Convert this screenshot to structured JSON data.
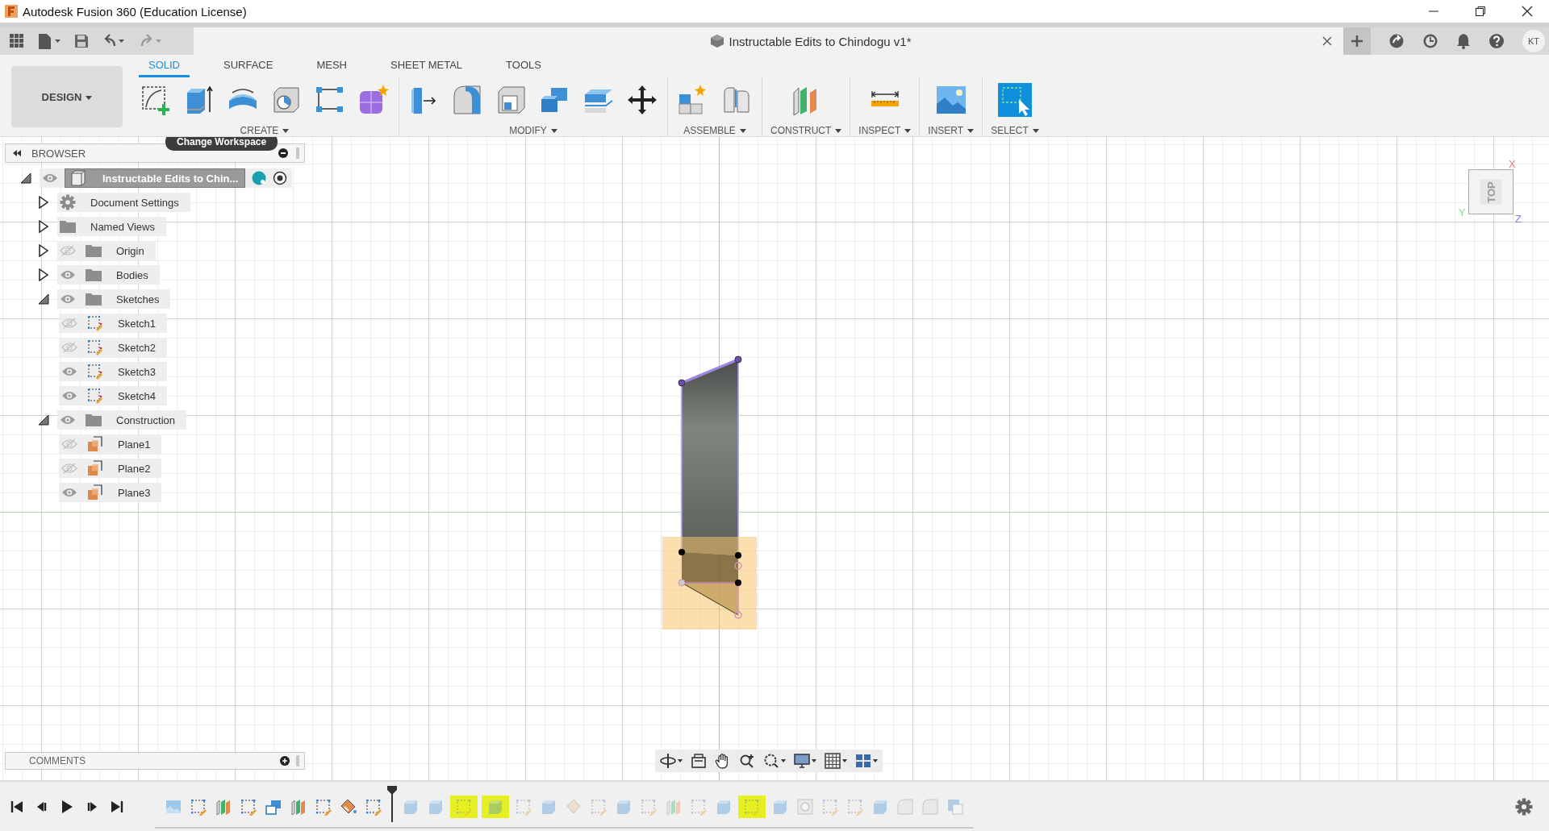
{
  "window": {
    "title": "Autodesk Fusion 360 (Education License)"
  },
  "document_tab": {
    "title": "Instructable Edits to Chindogu v1*"
  },
  "user": {
    "initials": "KT"
  },
  "workspace": {
    "label": "DESIGN"
  },
  "tabs": [
    {
      "label": "SOLID",
      "selected": true
    },
    {
      "label": "SURFACE",
      "selected": false
    },
    {
      "label": "MESH",
      "selected": false
    },
    {
      "label": "SHEET METAL",
      "selected": false
    },
    {
      "label": "TOOLS",
      "selected": false
    }
  ],
  "tool_groups": [
    {
      "label": "CREATE",
      "tools": [
        {
          "kind": "sketch"
        },
        {
          "kind": "extrude"
        },
        {
          "kind": "revolve"
        },
        {
          "kind": "hole"
        },
        {
          "kind": "pattern"
        },
        {
          "kind": "form"
        }
      ]
    },
    {
      "label": "MODIFY",
      "tools": [
        {
          "kind": "presspull"
        },
        {
          "kind": "fillet"
        },
        {
          "kind": "shell"
        },
        {
          "kind": "combine"
        },
        {
          "kind": "offset"
        },
        {
          "kind": "move"
        }
      ]
    },
    {
      "label": "ASSEMBLE",
      "tools": [
        {
          "kind": "component"
        },
        {
          "kind": "joint"
        }
      ]
    },
    {
      "label": "CONSTRUCT",
      "tools": [
        {
          "kind": "plane"
        }
      ]
    },
    {
      "label": "INSPECT",
      "tools": [
        {
          "kind": "measure"
        }
      ]
    },
    {
      "label": "INSERT",
      "tools": [
        {
          "kind": "image"
        }
      ]
    },
    {
      "label": "SELECT",
      "tools": [
        {
          "kind": "select"
        }
      ]
    }
  ],
  "tooltip": {
    "text": "Change Workspace"
  },
  "browser": {
    "title": "BROWSER",
    "root": {
      "label": "Instructable Edits to Chin...",
      "visible": true,
      "expanded": true,
      "selected": true
    },
    "items": [
      {
        "label": "Document Settings",
        "kind": "settings",
        "expanded": false
      },
      {
        "label": "Named Views",
        "kind": "folder",
        "expanded": false
      },
      {
        "label": "Origin",
        "kind": "folder",
        "visible": false,
        "expanded": false
      },
      {
        "label": "Bodies",
        "kind": "folder",
        "visible": true,
        "expanded": false
      },
      {
        "label": "Sketches",
        "kind": "folder",
        "visible": true,
        "expanded": true,
        "children": [
          {
            "label": "Sketch1",
            "kind": "sketch",
            "visible": false
          },
          {
            "label": "Sketch2",
            "kind": "sketch",
            "visible": false
          },
          {
            "label": "Sketch3",
            "kind": "sketch",
            "visible": true
          },
          {
            "label": "Sketch4",
            "kind": "sketch",
            "visible": true
          }
        ]
      },
      {
        "label": "Construction",
        "kind": "folder",
        "visible": true,
        "expanded": true,
        "children": [
          {
            "label": "Plane1",
            "kind": "plane",
            "visible": false
          },
          {
            "label": "Plane2",
            "kind": "plane",
            "visible": false
          },
          {
            "label": "Plane3",
            "kind": "plane",
            "visible": true
          }
        ]
      }
    ]
  },
  "comments": {
    "title": "COMMENTS"
  },
  "viewcube": {
    "face": "TOP",
    "x_axis": "X",
    "y_axis": "Y",
    "z_axis": "Z"
  },
  "timeline": {
    "features": [
      {
        "kind": "canvas",
        "active": true,
        "highlighted": false
      },
      {
        "kind": "sketch",
        "active": true,
        "highlighted": false
      },
      {
        "kind": "plane",
        "active": true,
        "highlighted": false
      },
      {
        "kind": "sketch",
        "active": true,
        "highlighted": false
      },
      {
        "kind": "combine",
        "active": true,
        "highlighted": false
      },
      {
        "kind": "plane",
        "active": true,
        "highlighted": false
      },
      {
        "kind": "sketch",
        "active": true,
        "highlighted": false
      },
      {
        "kind": "appearance",
        "active": true,
        "highlighted": false
      },
      {
        "kind": "sketch",
        "active": true,
        "highlighted": false
      },
      {
        "kind": "extrude",
        "active": false,
        "highlighted": false
      },
      {
        "kind": "extrude",
        "active": false,
        "highlighted": false
      },
      {
        "kind": "sketch",
        "active": false,
        "highlighted": true
      },
      {
        "kind": "extrude",
        "active": false,
        "highlighted": true
      },
      {
        "kind": "sketch",
        "active": false,
        "highlighted": false
      },
      {
        "kind": "extrude",
        "active": false,
        "highlighted": false
      },
      {
        "kind": "move",
        "active": false,
        "highlighted": false
      },
      {
        "kind": "sketch",
        "active": false,
        "highlighted": false
      },
      {
        "kind": "extrude",
        "active": false,
        "highlighted": false
      },
      {
        "kind": "sketch",
        "active": false,
        "highlighted": false
      },
      {
        "kind": "plane",
        "active": false,
        "highlighted": false
      },
      {
        "kind": "sketch",
        "active": false,
        "highlighted": false
      },
      {
        "kind": "extrude",
        "active": false,
        "highlighted": false
      },
      {
        "kind": "sketch",
        "active": false,
        "highlighted": true
      },
      {
        "kind": "extrude",
        "active": false,
        "highlighted": false
      },
      {
        "kind": "hole",
        "active": false,
        "highlighted": false
      },
      {
        "kind": "sketch",
        "active": false,
        "highlighted": false
      },
      {
        "kind": "sketch",
        "active": false,
        "highlighted": false
      },
      {
        "kind": "extrude",
        "active": false,
        "highlighted": false
      },
      {
        "kind": "fillet",
        "active": false,
        "highlighted": false
      },
      {
        "kind": "fillet",
        "active": false,
        "highlighted": false
      },
      {
        "kind": "box",
        "active": false,
        "highlighted": false
      }
    ]
  }
}
